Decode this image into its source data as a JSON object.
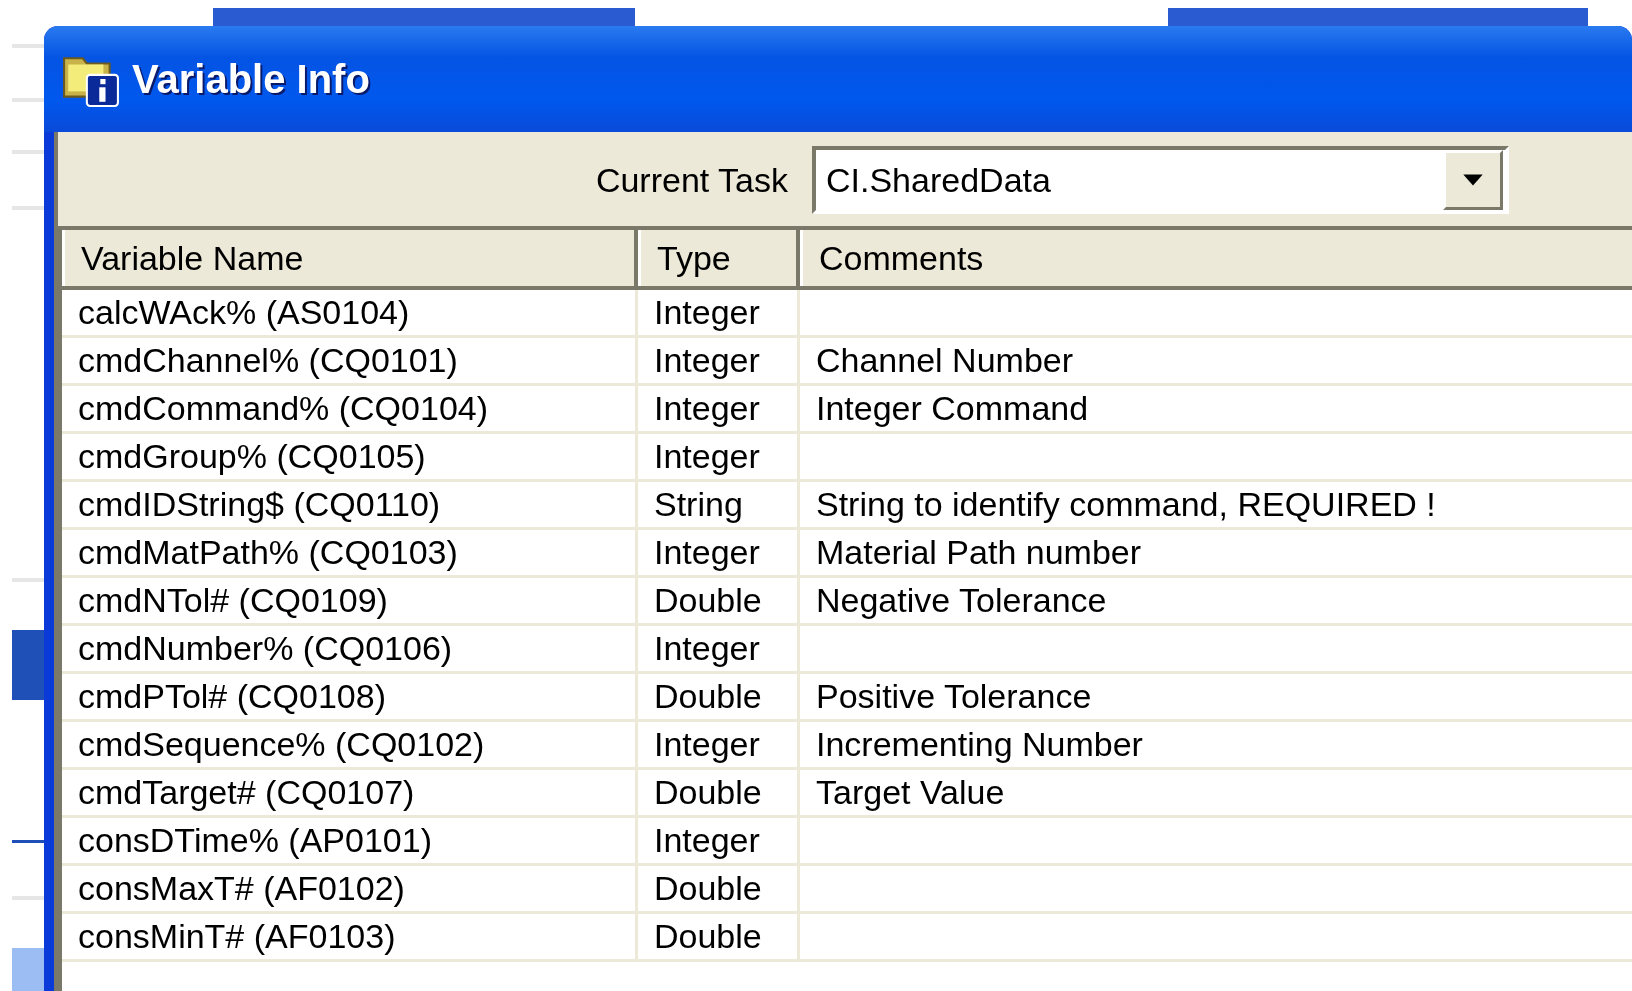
{
  "window": {
    "title": "Variable Info"
  },
  "current_task": {
    "label": "Current Task",
    "value": "CI.SharedData"
  },
  "table": {
    "columns": [
      "Variable Name",
      "Type",
      "Comments"
    ],
    "rows": [
      {
        "name": "calcWAck% (AS0104)",
        "type": "Integer"
      },
      {
        "name": "cmdChannel% (CQ0101)",
        "type": "Integer",
        "comment": "Channel Number"
      },
      {
        "name": "cmdCommand% (CQ0104)",
        "type": "Integer",
        "comment": "Integer Command"
      },
      {
        "name": "cmdGroup% (CQ0105)",
        "type": "Integer"
      },
      {
        "name": "cmdIDString$ (CQ0110)",
        "type": "String",
        "comment": "String to identify command, REQUIRED !"
      },
      {
        "name": "cmdMatPath% (CQ0103)",
        "type": "Integer",
        "comment": "Material Path number"
      },
      {
        "name": "cmdNTol# (CQ0109)",
        "type": "Double",
        "comment": "Negative Tolerance"
      },
      {
        "name": "cmdNumber% (CQ0106)",
        "type": "Integer"
      },
      {
        "name": "cmdPTol# (CQ0108)",
        "type": "Double",
        "comment": "Positive Tolerance"
      },
      {
        "name": "cmdSequence% (CQ0102)",
        "type": "Integer",
        "comment": "Incrementing Number"
      },
      {
        "name": "cmdTarget# (CQ0107)",
        "type": "Double",
        "comment": "Target Value"
      },
      {
        "name": "consDTime% (AP0101)",
        "type": "Integer"
      },
      {
        "name": "consMaxT# (AF0102)",
        "type": "Double"
      },
      {
        "name": "consMinT# (AF0103)",
        "type": "Double"
      }
    ]
  }
}
